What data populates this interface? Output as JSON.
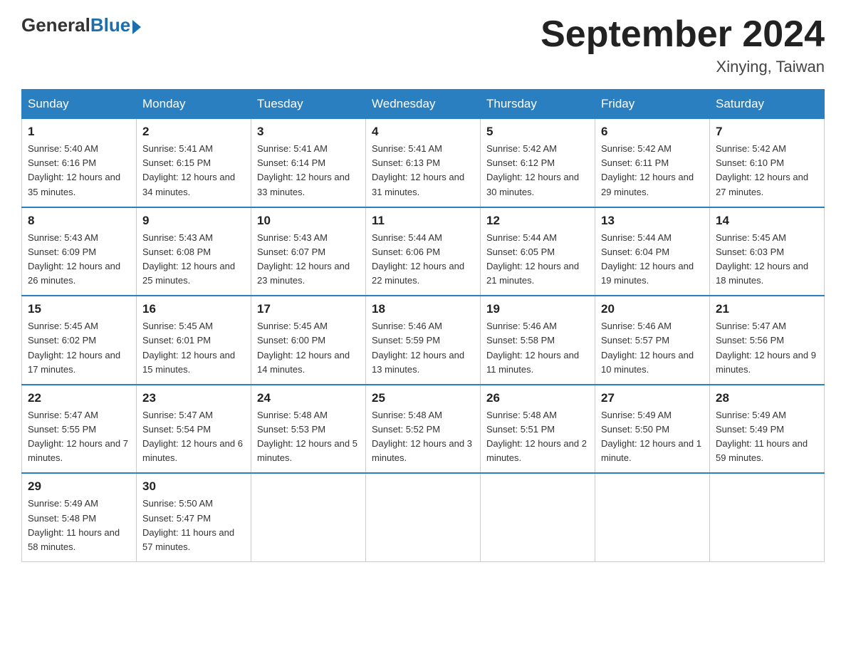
{
  "logo": {
    "general": "General",
    "blue": "Blue"
  },
  "title": "September 2024",
  "location": "Xinying, Taiwan",
  "headers": [
    "Sunday",
    "Monday",
    "Tuesday",
    "Wednesday",
    "Thursday",
    "Friday",
    "Saturday"
  ],
  "weeks": [
    [
      {
        "day": "1",
        "sunrise": "Sunrise: 5:40 AM",
        "sunset": "Sunset: 6:16 PM",
        "daylight": "Daylight: 12 hours and 35 minutes."
      },
      {
        "day": "2",
        "sunrise": "Sunrise: 5:41 AM",
        "sunset": "Sunset: 6:15 PM",
        "daylight": "Daylight: 12 hours and 34 minutes."
      },
      {
        "day": "3",
        "sunrise": "Sunrise: 5:41 AM",
        "sunset": "Sunset: 6:14 PM",
        "daylight": "Daylight: 12 hours and 33 minutes."
      },
      {
        "day": "4",
        "sunrise": "Sunrise: 5:41 AM",
        "sunset": "Sunset: 6:13 PM",
        "daylight": "Daylight: 12 hours and 31 minutes."
      },
      {
        "day": "5",
        "sunrise": "Sunrise: 5:42 AM",
        "sunset": "Sunset: 6:12 PM",
        "daylight": "Daylight: 12 hours and 30 minutes."
      },
      {
        "day": "6",
        "sunrise": "Sunrise: 5:42 AM",
        "sunset": "Sunset: 6:11 PM",
        "daylight": "Daylight: 12 hours and 29 minutes."
      },
      {
        "day": "7",
        "sunrise": "Sunrise: 5:42 AM",
        "sunset": "Sunset: 6:10 PM",
        "daylight": "Daylight: 12 hours and 27 minutes."
      }
    ],
    [
      {
        "day": "8",
        "sunrise": "Sunrise: 5:43 AM",
        "sunset": "Sunset: 6:09 PM",
        "daylight": "Daylight: 12 hours and 26 minutes."
      },
      {
        "day": "9",
        "sunrise": "Sunrise: 5:43 AM",
        "sunset": "Sunset: 6:08 PM",
        "daylight": "Daylight: 12 hours and 25 minutes."
      },
      {
        "day": "10",
        "sunrise": "Sunrise: 5:43 AM",
        "sunset": "Sunset: 6:07 PM",
        "daylight": "Daylight: 12 hours and 23 minutes."
      },
      {
        "day": "11",
        "sunrise": "Sunrise: 5:44 AM",
        "sunset": "Sunset: 6:06 PM",
        "daylight": "Daylight: 12 hours and 22 minutes."
      },
      {
        "day": "12",
        "sunrise": "Sunrise: 5:44 AM",
        "sunset": "Sunset: 6:05 PM",
        "daylight": "Daylight: 12 hours and 21 minutes."
      },
      {
        "day": "13",
        "sunrise": "Sunrise: 5:44 AM",
        "sunset": "Sunset: 6:04 PM",
        "daylight": "Daylight: 12 hours and 19 minutes."
      },
      {
        "day": "14",
        "sunrise": "Sunrise: 5:45 AM",
        "sunset": "Sunset: 6:03 PM",
        "daylight": "Daylight: 12 hours and 18 minutes."
      }
    ],
    [
      {
        "day": "15",
        "sunrise": "Sunrise: 5:45 AM",
        "sunset": "Sunset: 6:02 PM",
        "daylight": "Daylight: 12 hours and 17 minutes."
      },
      {
        "day": "16",
        "sunrise": "Sunrise: 5:45 AM",
        "sunset": "Sunset: 6:01 PM",
        "daylight": "Daylight: 12 hours and 15 minutes."
      },
      {
        "day": "17",
        "sunrise": "Sunrise: 5:45 AM",
        "sunset": "Sunset: 6:00 PM",
        "daylight": "Daylight: 12 hours and 14 minutes."
      },
      {
        "day": "18",
        "sunrise": "Sunrise: 5:46 AM",
        "sunset": "Sunset: 5:59 PM",
        "daylight": "Daylight: 12 hours and 13 minutes."
      },
      {
        "day": "19",
        "sunrise": "Sunrise: 5:46 AM",
        "sunset": "Sunset: 5:58 PM",
        "daylight": "Daylight: 12 hours and 11 minutes."
      },
      {
        "day": "20",
        "sunrise": "Sunrise: 5:46 AM",
        "sunset": "Sunset: 5:57 PM",
        "daylight": "Daylight: 12 hours and 10 minutes."
      },
      {
        "day": "21",
        "sunrise": "Sunrise: 5:47 AM",
        "sunset": "Sunset: 5:56 PM",
        "daylight": "Daylight: 12 hours and 9 minutes."
      }
    ],
    [
      {
        "day": "22",
        "sunrise": "Sunrise: 5:47 AM",
        "sunset": "Sunset: 5:55 PM",
        "daylight": "Daylight: 12 hours and 7 minutes."
      },
      {
        "day": "23",
        "sunrise": "Sunrise: 5:47 AM",
        "sunset": "Sunset: 5:54 PM",
        "daylight": "Daylight: 12 hours and 6 minutes."
      },
      {
        "day": "24",
        "sunrise": "Sunrise: 5:48 AM",
        "sunset": "Sunset: 5:53 PM",
        "daylight": "Daylight: 12 hours and 5 minutes."
      },
      {
        "day": "25",
        "sunrise": "Sunrise: 5:48 AM",
        "sunset": "Sunset: 5:52 PM",
        "daylight": "Daylight: 12 hours and 3 minutes."
      },
      {
        "day": "26",
        "sunrise": "Sunrise: 5:48 AM",
        "sunset": "Sunset: 5:51 PM",
        "daylight": "Daylight: 12 hours and 2 minutes."
      },
      {
        "day": "27",
        "sunrise": "Sunrise: 5:49 AM",
        "sunset": "Sunset: 5:50 PM",
        "daylight": "Daylight: 12 hours and 1 minute."
      },
      {
        "day": "28",
        "sunrise": "Sunrise: 5:49 AM",
        "sunset": "Sunset: 5:49 PM",
        "daylight": "Daylight: 11 hours and 59 minutes."
      }
    ],
    [
      {
        "day": "29",
        "sunrise": "Sunrise: 5:49 AM",
        "sunset": "Sunset: 5:48 PM",
        "daylight": "Daylight: 11 hours and 58 minutes."
      },
      {
        "day": "30",
        "sunrise": "Sunrise: 5:50 AM",
        "sunset": "Sunset: 5:47 PM",
        "daylight": "Daylight: 11 hours and 57 minutes."
      },
      null,
      null,
      null,
      null,
      null
    ]
  ]
}
